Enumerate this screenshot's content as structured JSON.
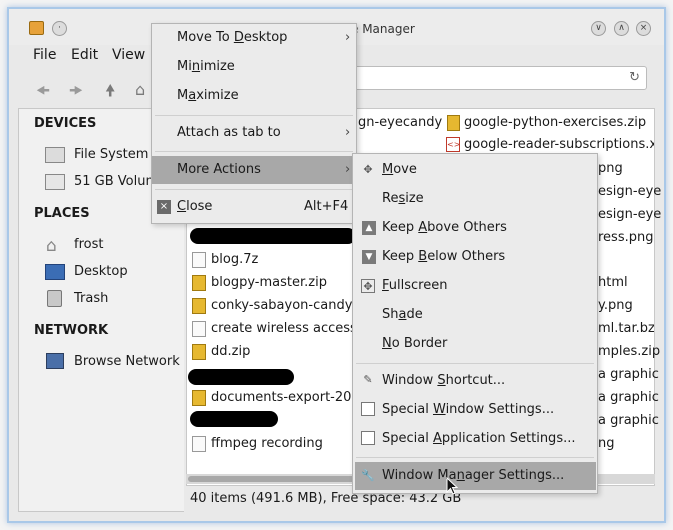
{
  "window": {
    "title": "File Manager",
    "title_visible": "e Manager"
  },
  "menubar": {
    "file": "File",
    "edit": "Edit",
    "view": "View"
  },
  "sidebar": {
    "devices_header": "DEVICES",
    "devices": [
      "File System",
      "51 GB Volum"
    ],
    "places_header": "PLACES",
    "places": [
      "frost",
      "Desktop",
      "Trash"
    ],
    "network_header": "NETWORK",
    "network": [
      "Browse Network"
    ]
  },
  "files": {
    "top_right": [
      "gn-eyecandy",
      "google-python-exercises.zip",
      "google-reader-subscriptions.xn"
    ],
    "left_column": [
      "blog.7z",
      "blogpy-master.zip",
      "conky-sabayon-candye",
      "create wireless access p",
      "dd.zip",
      "documents-export-2013",
      "ffmpeg recording"
    ],
    "right_column": [
      "png",
      "esign-eye",
      "esign-eye",
      "ress.png",
      "html",
      "y.png",
      "ml.tar.bz2",
      "mples.zip",
      "a graphic",
      "a graphic",
      "a graphic",
      "ng"
    ]
  },
  "status": {
    "text": "40 items (491.6 MB), Free space: 43.2 GB"
  },
  "window_menu": {
    "move_to_desktop": {
      "pre": "Move To ",
      "u": "D",
      "post": "esktop"
    },
    "minimize": {
      "pre": "Mi",
      "u": "n",
      "post": "imize"
    },
    "maximize": {
      "pre": "M",
      "u": "a",
      "post": "ximize"
    },
    "attach_as_tab": "Attach as tab to",
    "more_actions": "More Actions",
    "close": {
      "pre": "",
      "u": "C",
      "post": "lose"
    },
    "close_shortcut": "Alt+F4"
  },
  "more_actions_menu": {
    "move": {
      "pre": "",
      "u": "M",
      "post": "ove"
    },
    "resize": {
      "pre": "Re",
      "u": "s",
      "post": "ize"
    },
    "keep_above": {
      "pre": "Keep ",
      "u": "A",
      "post": "bove Others"
    },
    "keep_below": {
      "pre": "Keep ",
      "u": "B",
      "post": "elow Others"
    },
    "fullscreen": {
      "pre": "",
      "u": "F",
      "post": "ullscreen"
    },
    "shade": {
      "pre": "Sh",
      "u": "a",
      "post": "de"
    },
    "no_border": {
      "pre": "",
      "u": "N",
      "post": "o Border"
    },
    "window_shortcut": {
      "pre": "Window ",
      "u": "S",
      "post": "hortcut..."
    },
    "special_window": {
      "pre": "Special ",
      "u": "W",
      "post": "indow Settings..."
    },
    "special_app": {
      "pre": "Special ",
      "u": "A",
      "post": "pplication Settings..."
    },
    "wm_settings": {
      "pre": "Window Ma",
      "u": "n",
      "post": "ager Settings..."
    }
  }
}
